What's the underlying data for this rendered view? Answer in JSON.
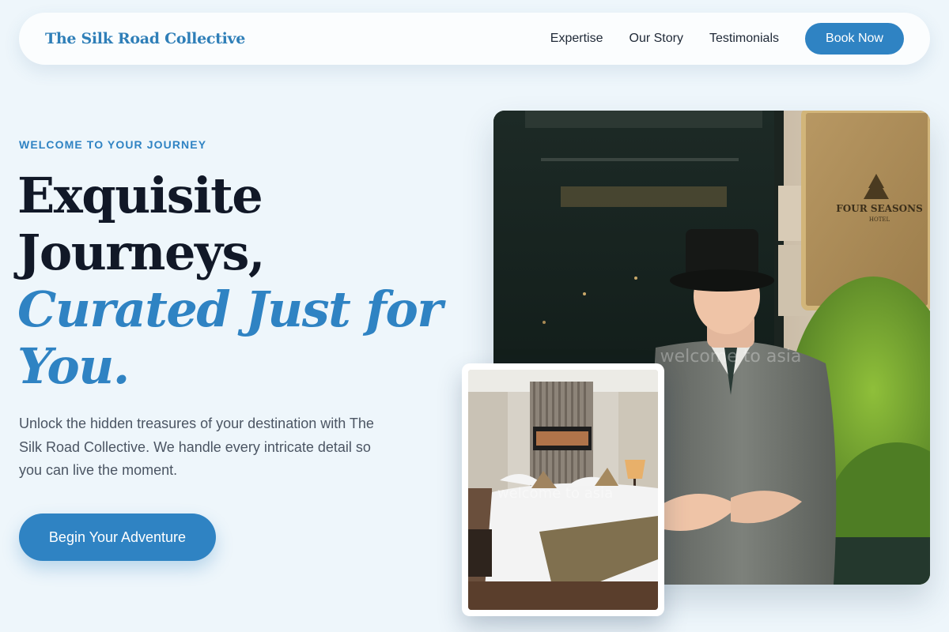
{
  "nav": {
    "brand": "The Silk Road Collective",
    "links": [
      "Expertise",
      "Our Story",
      "Testimonials"
    ],
    "cta": "Book Now"
  },
  "hero": {
    "eyebrow": "WELCOME TO YOUR JOURNEY",
    "headline_line1": "Exquisite",
    "headline_line2": "Journeys,",
    "headline_accent": "Curated Just for You.",
    "lede": "Unlock the hidden treasures of your destination with The Silk Road Collective. We handle every intricate detail so you can live the moment.",
    "cta": "Begin Your Adventure"
  },
  "images": {
    "main": "concierge-doorman-photo",
    "inset": "hotel-bedroom-photo",
    "sign_text_line1": "FOUR SEASONS",
    "sign_text_line2": "HOTEL",
    "watermark": "welcome to asia"
  },
  "colors": {
    "accent": "#2f83c3",
    "background": "#eef6fb",
    "heading": "#111827"
  }
}
